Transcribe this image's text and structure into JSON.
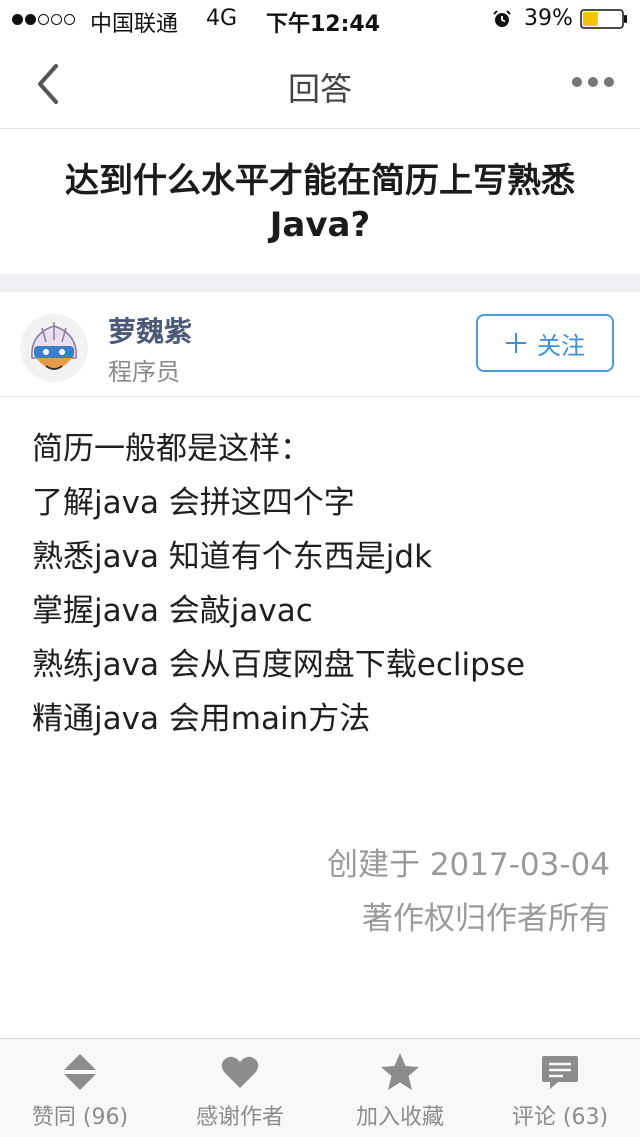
{
  "status_bar": {
    "signal_dots_filled": 2,
    "signal_dots_total": 5,
    "carrier": "中国联通",
    "network": "4G",
    "time": "下午12:44",
    "alarm_icon": "alarm-clock-icon",
    "battery_percent": "39%",
    "battery_level": 0.39,
    "battery_color": "#f5c400"
  },
  "nav": {
    "back_icon": "chevron-left-icon",
    "title": "回答",
    "more_icon": "more-dots-icon"
  },
  "question": {
    "title": "达到什么水平才能在简历上写熟悉Java?"
  },
  "author": {
    "name": "萝魏紫",
    "role": "程序员",
    "avatar_icon": "avatar-illustration",
    "follow_label": "关注",
    "follow_icon": "plus-icon",
    "accent_color": "#3f8fdc"
  },
  "answer": {
    "lines": [
      "简历一般都是这样：",
      "了解java 会拼这四个字",
      "熟悉java 知道有个东西是jdk",
      "掌握java 会敲javac",
      "熟练java 会从百度网盘下载eclipse",
      "精通java 会用main方法"
    ],
    "created": "创建于 2017-03-04",
    "copyright": "著作权归作者所有"
  },
  "toolbar": {
    "items": [
      {
        "icon": "vote-arrows-icon",
        "label": "赞同 (96)"
      },
      {
        "icon": "heart-icon",
        "label": "感谢作者"
      },
      {
        "icon": "star-icon",
        "label": "加入收藏"
      },
      {
        "icon": "comment-icon",
        "label": "评论 (63)"
      }
    ]
  }
}
